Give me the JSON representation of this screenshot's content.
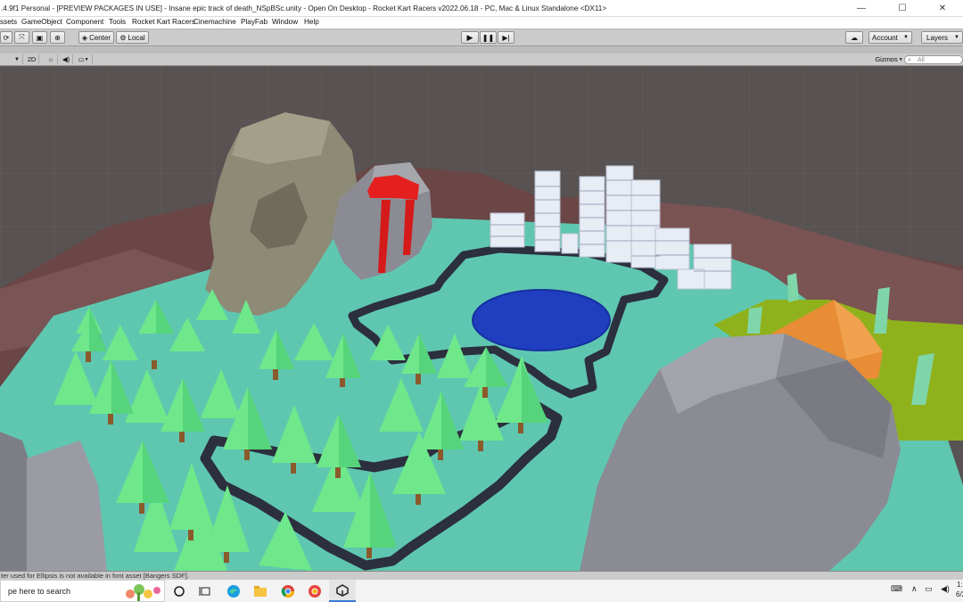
{
  "window": {
    "title": ".4.9f1 Personal - [PREVIEW PACKAGES IN USE] - Insane epic track of death_NSpBSc.unity - Open On Desktop - Rocket Kart Racers v2022.06.18 - PC, Mac & Linux Standalone <DX11>",
    "minimize": "—",
    "maximize": "☐",
    "close": "✕"
  },
  "menu": [
    "ssets",
    "GameObject",
    "Component",
    "Tools",
    "Rocket Kart Racers",
    "Cinemachine",
    "PlayFab",
    "Window",
    "Help"
  ],
  "toolbar": {
    "pivot_label": "Center",
    "space_label": "Local",
    "account_label": "Account",
    "layers_label": "Layers"
  },
  "scene_bar": {
    "mode_2d": "2D",
    "gizmos_label": "Gizmos",
    "search_placeholder": "All"
  },
  "console": {
    "message": "ter used for Ellipsis is not available in font asset [Bangers SDF]."
  },
  "taskbar": {
    "search_placeholder": "pe here to search",
    "time": "1:",
    "date": "6/2",
    "icons": [
      "cortana-icon",
      "task-view-icon",
      "edge-icon",
      "file-explorer-icon",
      "chrome-icon",
      "chrome-canary-icon",
      "unity-icon"
    ]
  },
  "colors": {
    "ground": "#5fc7b0",
    "track": "#2b2f3e",
    "lake": "#1f3fc0",
    "trees": "#6ee88a",
    "head": "#8d8a76",
    "rocks": "#8b8c93",
    "orange_rock": "#e88d36",
    "grass": "#8fb21c",
    "sky": "#595453"
  }
}
